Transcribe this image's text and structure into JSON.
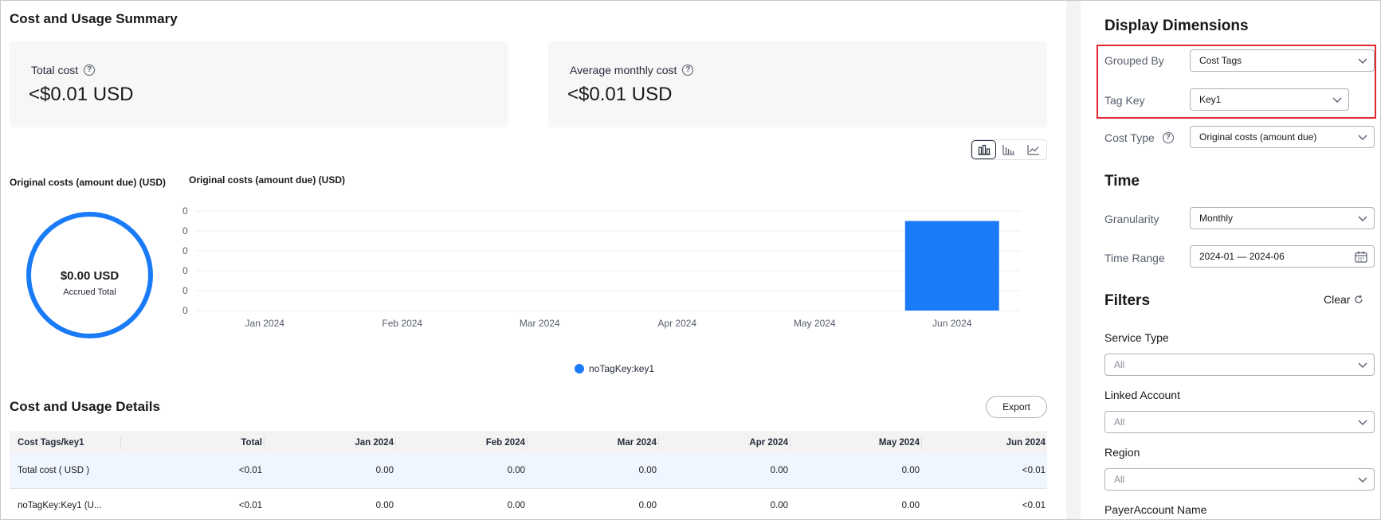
{
  "summary": {
    "title": "Cost and Usage Summary",
    "total_cost_label": "Total cost",
    "total_cost_value": "<$0.01 USD",
    "avg_cost_label": "Average monthly cost",
    "avg_cost_value": "<$0.01 USD"
  },
  "view_toggle": {
    "options": [
      "grouped-bar-chart-icon",
      "stacked-bar-chart-icon",
      "line-chart-icon"
    ],
    "active": "grouped-bar-chart-icon"
  },
  "donut": {
    "title": "Original costs (amount due) (USD)",
    "value": "$0.00 USD",
    "label": "Accrued Total",
    "color": "#1a7bf9"
  },
  "chart_data": {
    "type": "bar",
    "title": "Original costs (amount due) (USD)",
    "categories": [
      "Jan 2024",
      "Feb 2024",
      "Mar 2024",
      "Apr 2024",
      "May 2024",
      "Jun 2024"
    ],
    "y_tick_labels": [
      "0",
      "0",
      "0",
      "0",
      "0",
      "0"
    ],
    "series": [
      {
        "name": "noTagKey:key1",
        "color": "#1a7bf9",
        "values": [
          0,
          0,
          0,
          0,
          0,
          0.0045
        ]
      }
    ],
    "ylim": [
      0,
      0.005
    ],
    "grid": true,
    "legend": "bottom-center"
  },
  "details": {
    "title": "Cost and Usage Details",
    "export_label": "Export",
    "columns": [
      "Cost Tags/key1",
      "Total",
      "Jan 2024",
      "Feb 2024",
      "Mar 2024",
      "Apr 2024",
      "May 2024",
      "Jun 2024"
    ],
    "rows": [
      [
        "Total cost ( USD )",
        "<0.01",
        "0.00",
        "0.00",
        "0.00",
        "0.00",
        "0.00",
        "<0.01"
      ],
      [
        "noTagKey:Key1 (U...",
        "<0.01",
        "0.00",
        "0.00",
        "0.00",
        "0.00",
        "0.00",
        "<0.01"
      ]
    ]
  },
  "sidebar": {
    "display_title": "Display Dimensions",
    "grouped_by_label": "Grouped By",
    "grouped_by_value": "Cost Tags",
    "tag_key_label": "Tag Key",
    "tag_key_value": "Key1",
    "cost_type_label": "Cost Type",
    "cost_type_value": "Original costs (amount due)",
    "time_title": "Time",
    "granularity_label": "Granularity",
    "granularity_value": "Monthly",
    "time_range_label": "Time Range",
    "time_range_value": "2024-01 — 2024-06",
    "filters_title": "Filters",
    "clear_label": "Clear",
    "service_type_label": "Service Type",
    "service_type_value": "All",
    "linked_account_label": "Linked Account",
    "linked_account_value": "All",
    "region_label": "Region",
    "region_value": "All",
    "payer_label": "PayerAccount Name",
    "highlight_color": "#e5262f"
  }
}
